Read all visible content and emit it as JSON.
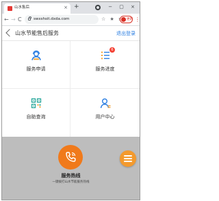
{
  "browser": {
    "tab_title": "山水售后",
    "tab_close": "×",
    "new_tab": "+",
    "window_controls": "− ▢ ×",
    "url": "swxshsit.dxda.com",
    "extension_icons": "☆ ★ ≡",
    "update_label": "更新",
    "menu": "⋮",
    "nav": {
      "back": "←",
      "forward": "→",
      "reload": "C"
    }
  },
  "header": {
    "title": "山水节能售后服务",
    "logout": "退出登录"
  },
  "grid": [
    {
      "label": "服务申请",
      "icon": "person-headset-icon"
    },
    {
      "label": "服务进度",
      "icon": "list-icon",
      "badge": "6"
    },
    {
      "label": "自助查询",
      "icon": "qrcode-icon"
    },
    {
      "label": "用户中心",
      "icon": "user-icon"
    }
  ],
  "hotline": {
    "title": "服务热线",
    "subtitle": "一键拨打山水节能服务热线",
    "icon": "phone-icon"
  },
  "colors": {
    "accent": "#2a7de1",
    "orange": "#f07a1b",
    "badge": "#f44336"
  }
}
